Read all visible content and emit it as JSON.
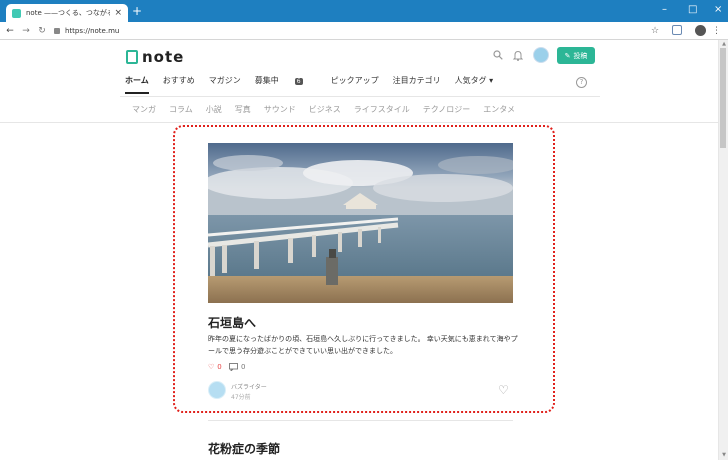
{
  "browser": {
    "tab_title": "note ——つくる、つながる、とどける。",
    "tab_close": "×",
    "new_tab": "+",
    "url": "https://note.mu",
    "win_min": "–",
    "win_max": "□",
    "win_close": "×"
  },
  "header": {
    "logo_text": "note",
    "post_button_label": "投稿"
  },
  "main_nav": {
    "items": [
      {
        "label": "ホーム"
      },
      {
        "label": "おすすめ"
      },
      {
        "label": "マガジン"
      },
      {
        "label": "募集中",
        "badge": "6"
      },
      {
        "label": "ピックアップ"
      },
      {
        "label": "注目カテゴリ"
      },
      {
        "label": "人気タグ ▾"
      }
    ],
    "help": "?"
  },
  "sub_nav": {
    "items": [
      "マンガ",
      "コラム",
      "小説",
      "写真",
      "サウンド",
      "ビジネス",
      "ライフスタイル",
      "テクノロジー",
      "エンタメ"
    ]
  },
  "article": {
    "title": "石垣島へ",
    "excerpt": "昨年の夏になったばかりの頃、石垣島へ久しぶりに行ってきました。 幸い天気にも恵まれて海やプールで思う存分遊ぶことができていい思い出ができました。",
    "likes": "0",
    "comments": "0",
    "author": "バズライター",
    "time": "47分前"
  },
  "next_article": {
    "title": "花粉症の季節"
  },
  "colors": {
    "accent": "#2cb696",
    "highlight": "#e0211c",
    "chrome": "#1e7fc0"
  }
}
